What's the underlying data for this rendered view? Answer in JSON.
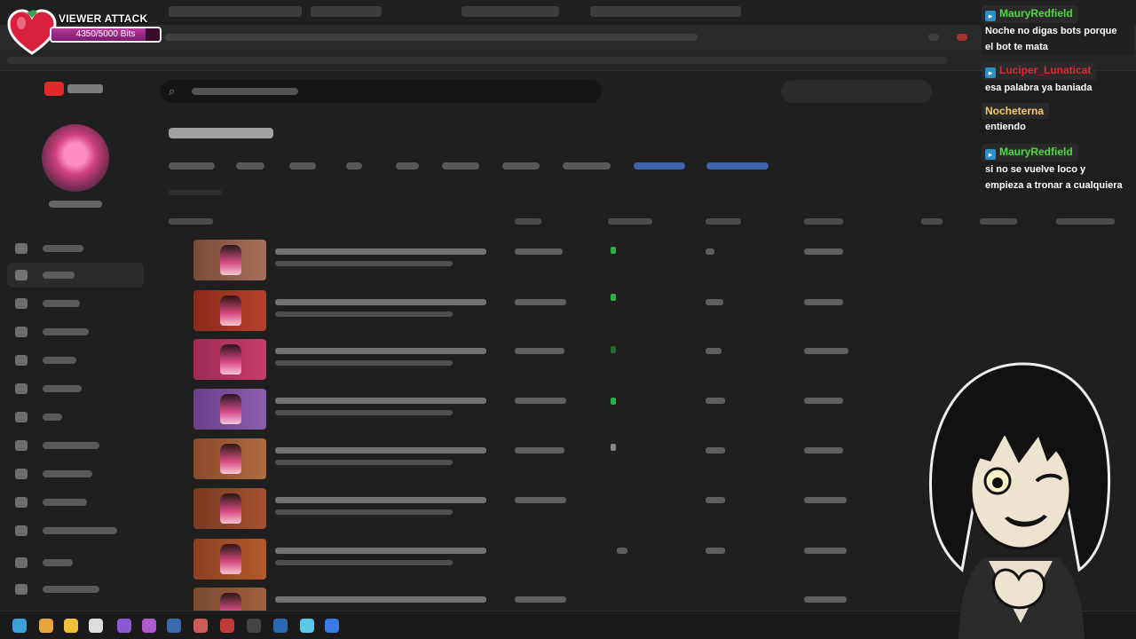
{
  "overlay": {
    "viewer_attack": {
      "title": "VIEWER ATTACK",
      "progress_text": "4350/5000 Bits",
      "progress_value": 4350,
      "progress_max": 5000,
      "heart_color": "#d9213f"
    },
    "chat": [
      {
        "user": "MauryRedfield",
        "color": "#4ddc3c",
        "lines": [
          "Noche no digas bots porque",
          "el bot te mata"
        ]
      },
      {
        "user": "Luciper_Lunaticat",
        "color": "#e0263b",
        "lines": [
          "esa palabra ya baniada"
        ]
      },
      {
        "user": "Nocheterna",
        "color": "#f5c86a",
        "lines": [
          "entiendo"
        ]
      },
      {
        "user": "MauryRedfield",
        "color": "#4ddc3c",
        "lines": [
          "si no se vuelve loco y",
          "empieza a tronar a cualquiera"
        ]
      }
    ]
  },
  "icons": {
    "heart": "heart-icon",
    "search": "search-icon",
    "chat_badge": "prime-badge-icon"
  },
  "colors": {
    "background": "#1f1f1f",
    "accent_red": "#e32a2a",
    "bar_fill": "#9a2a86"
  }
}
